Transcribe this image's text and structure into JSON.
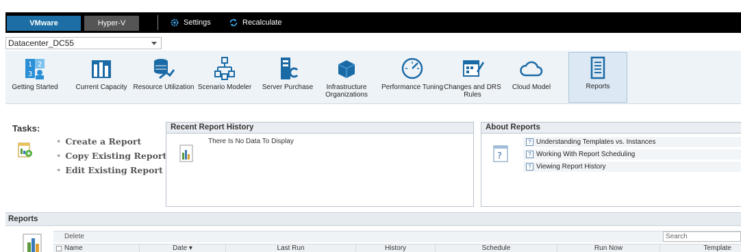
{
  "topbar": {
    "tabs": [
      {
        "label": "VMware",
        "active": true
      },
      {
        "label": "Hyper-V",
        "active": false
      }
    ],
    "settings_label": "Settings",
    "recalculate_label": "Recalculate"
  },
  "datacenter_select": {
    "value": "Datacenter_DC55"
  },
  "ribbon": {
    "items": [
      {
        "label": "Getting Started",
        "icon": "getting-started-icon"
      },
      {
        "label": "Current Capacity",
        "icon": "capacity-bars-icon"
      },
      {
        "label": "Resource Utilization",
        "icon": "resource-utilization-icon"
      },
      {
        "label": "Scenario Modeler",
        "icon": "scenario-modeler-icon"
      },
      {
        "label": "Server Purchase",
        "icon": "server-purchase-icon"
      },
      {
        "label": "Infrastructure Organizations",
        "icon": "infrastructure-icon"
      },
      {
        "label": "Performance Tuning",
        "icon": "gauge-icon"
      },
      {
        "label": "Changes and DRS Rules",
        "icon": "calendar-edit-icon"
      },
      {
        "label": "Cloud Model",
        "icon": "cloud-icon"
      },
      {
        "label": "Reports",
        "icon": "report-document-icon",
        "active": true
      }
    ]
  },
  "tasks": {
    "title": "Tasks:",
    "items": [
      "Create a Report",
      "Copy Existing Report",
      "Edit Existing Report"
    ]
  },
  "recent_history": {
    "title": "Recent Report History",
    "empty_text": "There Is No Data To Display"
  },
  "about": {
    "title": "About Reports",
    "links": [
      "Understanding Templates vs. Instances",
      "Working With Report Scheduling",
      "Viewing Report History"
    ]
  },
  "reports": {
    "title": "Reports",
    "delete_label": "Delete",
    "search_placeholder": "Search",
    "columns": [
      "Name",
      "Date ▾",
      "Last Run",
      "History",
      "Schedule",
      "Run Now",
      "Template"
    ]
  },
  "colors": {
    "accent": "#1c6ea4",
    "toolbar_bg": "#000000",
    "ribbon_bg": "#eef3f7"
  }
}
